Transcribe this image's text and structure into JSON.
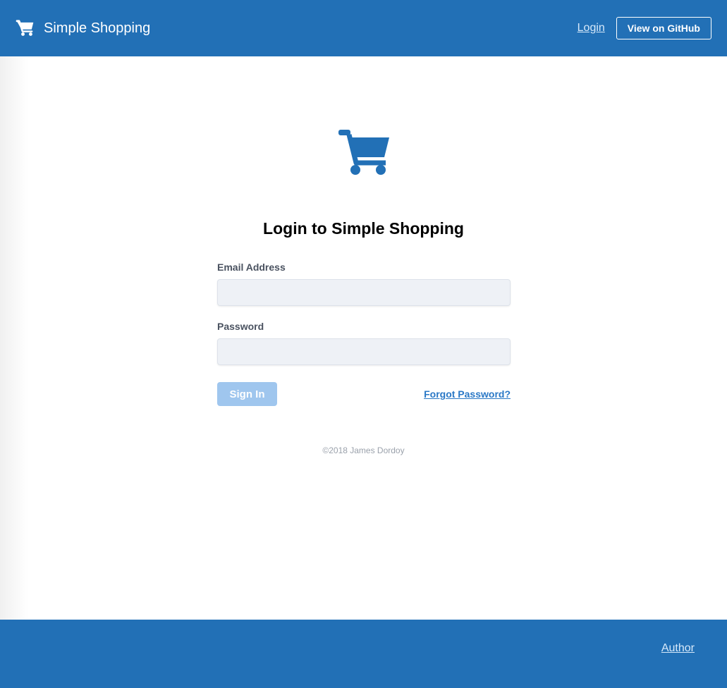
{
  "navbar": {
    "brand_icon": "shopping-cart-icon",
    "title": "Simple Shopping",
    "login_link": "Login",
    "github_button": "View on GitHub",
    "background_color": "#2270b6"
  },
  "main": {
    "icon": "shopping-cart-icon",
    "icon_color": "#2270b6",
    "title": "Login to Simple Shopping"
  },
  "form": {
    "email_label": "Email Address",
    "email_value": "",
    "email_placeholder": "",
    "password_label": "Password",
    "password_value": "",
    "password_placeholder": "",
    "signin_button": "Sign In",
    "forgot_link": "Forgot Password?"
  },
  "copyright": "©2018 James Dordoy",
  "footer": {
    "author_link": "Author"
  }
}
